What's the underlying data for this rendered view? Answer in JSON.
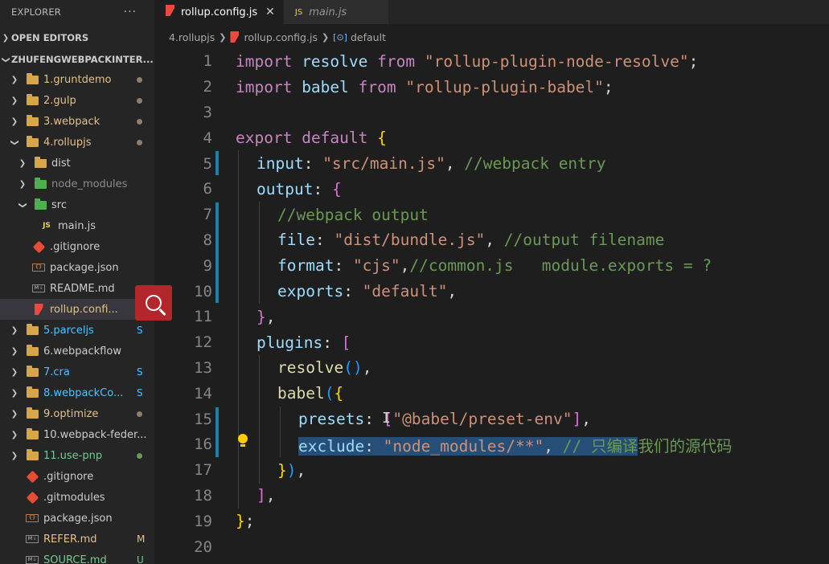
{
  "explorer": {
    "title": "EXPLORER",
    "more": "···",
    "open_editors": "OPEN EDITORS",
    "workspace": "ZHUFENGWEBPACKINTER...",
    "items": [
      {
        "label": "1.gruntdemo",
        "badge": "dot"
      },
      {
        "label": "2.gulp",
        "badge": "dot"
      },
      {
        "label": "3.webpack",
        "badge": "dot"
      },
      {
        "label": "4.rollupjs",
        "badge": "dot"
      },
      {
        "label": "dist",
        "badge": ""
      },
      {
        "label": "node_modules",
        "badge": ""
      },
      {
        "label": "src",
        "badge": ""
      },
      {
        "label": "main.js",
        "badge": ""
      },
      {
        "label": ".gitignore",
        "badge": ""
      },
      {
        "label": "package.json",
        "badge": ""
      },
      {
        "label": "README.md",
        "badge": ""
      },
      {
        "label": "rollup.confi...",
        "badge": "M"
      },
      {
        "label": "5.parceljs",
        "badge": "S"
      },
      {
        "label": "6.webpackflow",
        "badge": ""
      },
      {
        "label": "7.cra",
        "badge": "S"
      },
      {
        "label": "8.webpackCo...",
        "badge": "S"
      },
      {
        "label": "9.optimize",
        "badge": "dot"
      },
      {
        "label": "10.webpack-feder...",
        "badge": ""
      },
      {
        "label": "11.use-pnp",
        "badge": "dot"
      },
      {
        "label": ".gitignore",
        "badge": ""
      },
      {
        "label": ".gitmodules",
        "badge": ""
      },
      {
        "label": "package.json",
        "badge": ""
      },
      {
        "label": "REFER.md",
        "badge": "M"
      },
      {
        "label": "SOURCE.md",
        "badge": "U"
      }
    ]
  },
  "tabs": [
    {
      "label": "rollup.config.js",
      "close": "✕",
      "icon": "JS"
    },
    {
      "label": "main.js",
      "icon": "JS"
    }
  ],
  "breadcrumb": {
    "folder": "4.rollupjs",
    "file": "rollup.config.js",
    "symbol": "default"
  },
  "code": {
    "line_numbers": [
      "1",
      "2",
      "3",
      "4",
      "5",
      "6",
      "7",
      "8",
      "9",
      "10",
      "11",
      "12",
      "13",
      "14",
      "15",
      "16",
      "17",
      "18",
      "19",
      "20"
    ],
    "tokens": {
      "l1": [
        "import",
        " resolve ",
        "from",
        " ",
        "\"rollup-plugin-node-resolve\"",
        ";"
      ],
      "l2": [
        "import",
        " babel ",
        "from",
        " ",
        "\"rollup-plugin-babel\"",
        ";"
      ],
      "l4": [
        "export",
        " ",
        "default",
        " ",
        "{"
      ],
      "l5": [
        "input",
        ": ",
        "\"src/main.js\"",
        ", ",
        "//webpack entry"
      ],
      "l6": [
        "output",
        ": ",
        "{"
      ],
      "l7": [
        "//webpack output"
      ],
      "l8": [
        "file",
        ": ",
        "\"dist/bundle.js\"",
        ", ",
        "//output filename"
      ],
      "l9": [
        "format",
        ": ",
        "\"cjs\"",
        ",",
        "//common.js   module.exports = ?"
      ],
      "l10": [
        "exports",
        ": ",
        "\"default\"",
        ","
      ],
      "l11": [
        "}",
        ","
      ],
      "l12": [
        "plugins",
        ": ",
        "["
      ],
      "l13": [
        "resolve",
        "(",
        ")",
        ","
      ],
      "l14": [
        "babel",
        "(",
        "{"
      ],
      "l15": [
        "presets",
        ": ",
        "[",
        "\"@babel/preset-env\"",
        "]",
        ","
      ],
      "l16": [
        "exclude",
        ": ",
        "\"node_modules/**\"",
        ", ",
        "// 只编译",
        "我们的源代码"
      ],
      "l17": [
        "}",
        ")",
        ","
      ],
      "l18": [
        "]",
        ","
      ],
      "l19": [
        "}",
        ";"
      ]
    }
  },
  "colors": {
    "keyword": "#569cd6",
    "string": "#ce9178",
    "property": "#9cdcfe",
    "function": "#dcdcaa",
    "comment": "#6a9955",
    "selection": "#264f78"
  }
}
